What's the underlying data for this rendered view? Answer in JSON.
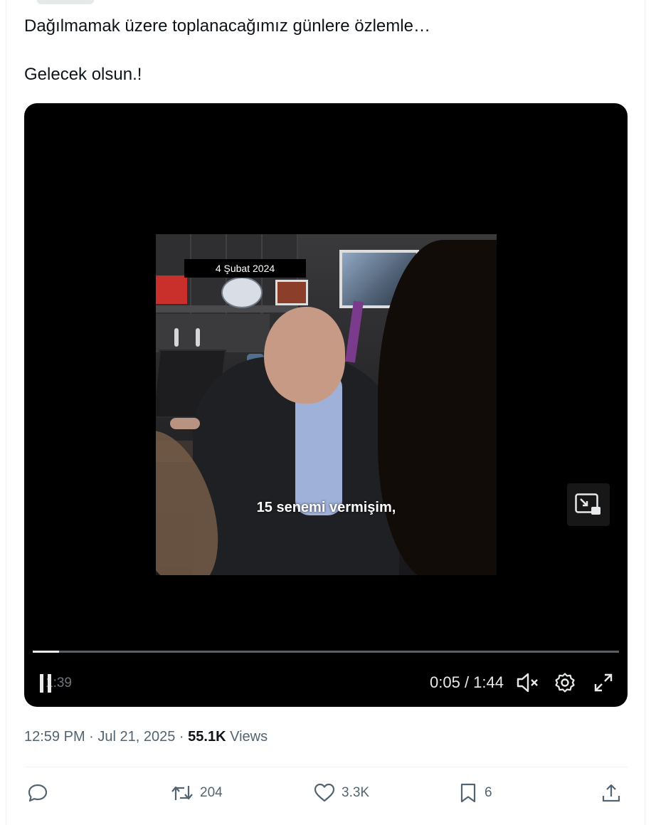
{
  "tweet": {
    "lines": [
      "Dağılmamak üzere toplanacağımız günlere özlemle…",
      "Gelecek olsun.!"
    ]
  },
  "video": {
    "date_overlay": "4 Şubat 2024",
    "subtitle": "15 senemi vermişim,",
    "ghost_time": "1:39",
    "current_time": "0:05",
    "duration": "1:44",
    "time_display": "0:05 / 1:44",
    "progress_fraction": 0.045,
    "muted": true
  },
  "meta": {
    "time": "12:59 PM",
    "separator": " · ",
    "date": "Jul 21, 2025",
    "views_count": "55.1K",
    "views_label": "Views"
  },
  "actions": {
    "reply": {
      "icon": "reply-icon",
      "count": ""
    },
    "retweet": {
      "icon": "retweet-icon",
      "count": "204"
    },
    "like": {
      "icon": "heart-icon",
      "count": "3.3K"
    },
    "bookmark": {
      "icon": "bookmark-icon",
      "count": "6"
    },
    "share": {
      "icon": "share-icon",
      "count": ""
    }
  },
  "colors": {
    "text_primary": "#0f1419",
    "text_secondary": "#536471",
    "video_bg": "#000000",
    "divider": "#eff3f4"
  }
}
